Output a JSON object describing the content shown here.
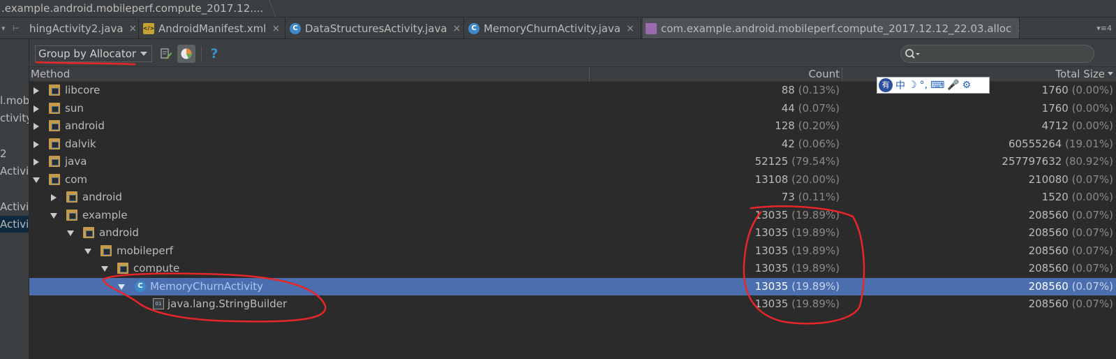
{
  "breadcrumb": {
    "text": ".example.android.mobileperf.compute_2017.12...."
  },
  "tabs": [
    {
      "label": "hingActivity2.java",
      "icon": "java-file-icon",
      "active": false
    },
    {
      "label": "AndroidManifest.xml",
      "icon": "xml-file-icon",
      "active": false
    },
    {
      "label": "DataStructuresActivity.java",
      "icon": "class-icon",
      "active": false
    },
    {
      "label": "MemoryChurnActivity.java",
      "icon": "class-icon",
      "active": false
    },
    {
      "label": "com.example.android.mobileperf.compute_2017.12.12_22.03.alloc",
      "icon": "alloc-file-icon",
      "active": true
    }
  ],
  "tab_close_glyph": "×",
  "tab_overflow_glyph": "▾≡4",
  "left_strip": [
    "l.mob",
    "ctivity",
    "2",
    "Activit",
    "Activit",
    "Activit"
  ],
  "toolbar": {
    "group_by_label": "Group by Allocator",
    "help_glyph": "?"
  },
  "table": {
    "headers": {
      "method": "Method",
      "count": "Count",
      "total_size": "Total Size"
    },
    "rows": [
      {
        "name": "libcore",
        "count": "88",
        "count_pct": "(0.13%)",
        "size": "1760",
        "size_pct": "(0.00%)"
      },
      {
        "name": "sun",
        "count": "44",
        "count_pct": "(0.07%)",
        "size": "1760",
        "size_pct": "(0.00%)"
      },
      {
        "name": "android",
        "count": "128",
        "count_pct": "(0.20%)",
        "size": "4712",
        "size_pct": "(0.00%)"
      },
      {
        "name": "dalvik",
        "count": "42",
        "count_pct": "(0.06%)",
        "size": "60555264",
        "size_pct": "(19.01%)"
      },
      {
        "name": "java",
        "count": "52125",
        "count_pct": "(79.54%)",
        "size": "257797632",
        "size_pct": "(80.92%)"
      },
      {
        "name": "com",
        "count": "13108",
        "count_pct": "(20.00%)",
        "size": "210080",
        "size_pct": "(0.07%)"
      },
      {
        "name": "android",
        "count": "73",
        "count_pct": "(0.11%)",
        "size": "1520",
        "size_pct": "(0.00%)"
      },
      {
        "name": "example",
        "count": "13035",
        "count_pct": "(19.89%)",
        "size": "208560",
        "size_pct": "(0.07%)"
      },
      {
        "name": "android",
        "count": "13035",
        "count_pct": "(19.89%)",
        "size": "208560",
        "size_pct": "(0.07%)"
      },
      {
        "name": "mobileperf",
        "count": "13035",
        "count_pct": "(19.89%)",
        "size": "208560",
        "size_pct": "(0.07%)"
      },
      {
        "name": "compute",
        "count": "13035",
        "count_pct": "(19.89%)",
        "size": "208560",
        "size_pct": "(0.07%)"
      },
      {
        "name": "MemoryChurnActivity",
        "count": "13035",
        "count_pct": "(19.89%)",
        "size": "208560",
        "size_pct": "(0.07%)"
      },
      {
        "name": "java.lang.StringBuilder",
        "count": "13035",
        "count_pct": "(19.89%)",
        "size": "208560",
        "size_pct": "(0.07%)"
      }
    ]
  },
  "ime": {
    "logo": "有",
    "items": [
      "中",
      "☽",
      "°,",
      "⌨",
      "🎤",
      "⚙"
    ]
  },
  "colors": {
    "selection": "#4b6eaf",
    "annotation": "#e8262a",
    "background": "#2b2b2b"
  }
}
